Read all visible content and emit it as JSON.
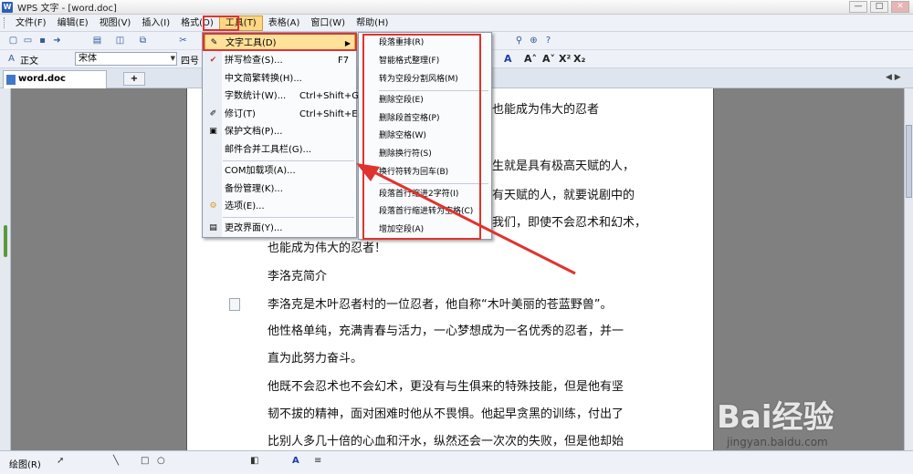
{
  "window": {
    "title": "WPS 文字 - [word.doc]",
    "logo": "W"
  },
  "menubar": {
    "items": [
      "文件(F)",
      "编辑(E)",
      "视图(V)",
      "插入(I)",
      "格式(O)",
      "工具(T)",
      "表格(A)",
      "窗口(W)",
      "帮助(H)"
    ],
    "active_index": 5
  },
  "toolbar2": {
    "style": "正文",
    "font": "宋体",
    "size": "四号"
  },
  "tab": {
    "label": "word.doc",
    "plus": "+"
  },
  "document": {
    "lines": [
      "也能成为伟大的忍者",
      "生就是具有极高天赋的人，",
      "有天赋的人，就要说剧中的",
      "我们，即使不会忍术和幻术，",
      "也能成为伟大的忍者！",
      "李洛克简介",
      "李洛克是木叶忍者村的一位忍者，他自称“木叶美丽的苍蓝野兽”。",
      "他性格单纯，充满青春与活力，一心梦想成为一名优秀的忍者，并一",
      "直为此努力奋斗。",
      "他既不会忍术也不会幻术，更没有与生俱来的特殊技能，但是他有坚",
      "韧不拔的精神，面对困难时他从不畏惧。他起早贪黑的训练，付出了",
      "比别人多几十倍的心血和汗水，纵然还会一次次的失败，但是他却始"
    ]
  },
  "tools_menu": {
    "items": [
      {
        "label": "文字工具(D)",
        "shortcut": "",
        "icon": "text-tool-icon",
        "glyph": "✎"
      },
      {
        "label": "拼写检查(S)...",
        "shortcut": "F7",
        "icon": "spell-check-icon",
        "glyph": "✔"
      },
      {
        "label": "中文简繁转换(H)...",
        "shortcut": "",
        "icon": "",
        "glyph": ""
      },
      {
        "label": "字数统计(W)...",
        "shortcut": "Ctrl+Shift+G",
        "icon": "",
        "glyph": ""
      },
      {
        "label": "修订(T)",
        "shortcut": "Ctrl+Shift+E",
        "icon": "revision-icon",
        "glyph": "✐"
      },
      {
        "label": "保护文档(P)...",
        "shortcut": "",
        "icon": "protect-document-icon",
        "glyph": "▣"
      },
      {
        "label": "邮件合并工具栏(G)...",
        "shortcut": "",
        "icon": "",
        "glyph": ""
      },
      {
        "label": "COM加载项(A)...",
        "shortcut": "",
        "icon": "",
        "glyph": ""
      },
      {
        "label": "备份管理(K)...",
        "shortcut": "",
        "icon": "",
        "glyph": ""
      },
      {
        "label": "选项(E)...",
        "shortcut": "",
        "icon": "options-gear-icon",
        "glyph": "⚙"
      },
      {
        "label": "更改界面(Y)...",
        "shortcut": "",
        "icon": "change-ui-icon",
        "glyph": "▤"
      }
    ]
  },
  "text_tools_submenu": {
    "items": [
      "段落重排(R)",
      "智能格式整理(F)",
      "转为空段分割风格(M)",
      "删除空段(E)",
      "删除段首空格(P)",
      "删除空格(W)",
      "删除换行符(S)",
      "换行符转为回车(B)",
      "段落首行缩进2字符(I)",
      "段落首行缩进转为空格(C)",
      "增加空段(A)"
    ]
  },
  "drawbar": {
    "label": "绘图(R)"
  },
  "watermark": {
    "brand": "Bai经验",
    "url": "jingyan.baidu.com"
  },
  "colors": {
    "highlight": "#ffe29a",
    "annotation": "#e0332f",
    "menubar_bg": "#eef1f7"
  }
}
